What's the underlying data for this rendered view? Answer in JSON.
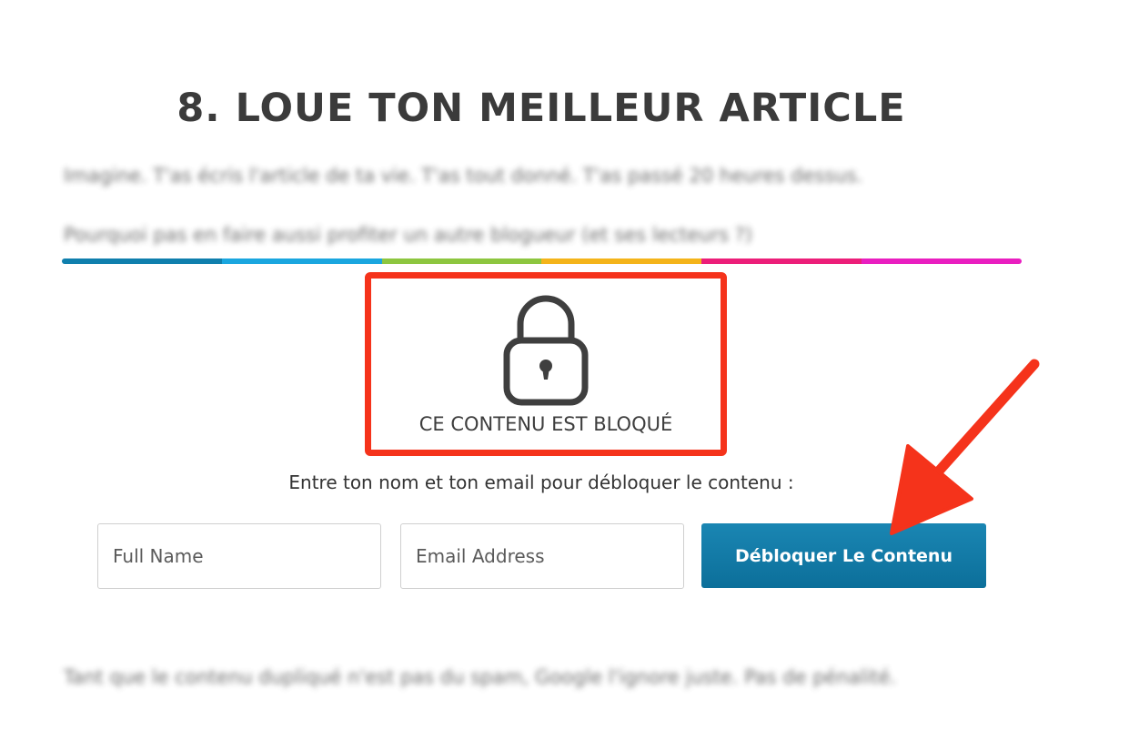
{
  "section": {
    "heading": "8. LOUE TON MEILLEUR ARTICLE",
    "paragraphs": [
      "Imagine. T'as écris l'article de ta vie. T'as tout donné. T'as passé 20 heures dessus.",
      "Pourquoi pas en faire aussi profiter un autre blogueur (et ses lecteurs ?)",
      "Tant que le contenu dupliqué n'est pas du spam, Google l'ignore juste. Pas de pénalité."
    ]
  },
  "divider": {
    "colors": [
      "#0f7fad",
      "#1aa6df",
      "#8dc63f",
      "#f4b41a",
      "#ec1e79",
      "#e91ec0"
    ]
  },
  "locked_box": {
    "icon": "padlock-icon",
    "label": "CE CONTENU EST BLOQUÉ",
    "highlight_color": "#f5331b"
  },
  "unlock_form": {
    "instruction": "Entre ton nom et ton email pour débloquer le contenu :",
    "name_placeholder": "Full Name",
    "email_placeholder": "Email Address",
    "button_label": "Débloquer Le Contenu",
    "button_color": "#0e78a5"
  },
  "annotation": {
    "icon": "red-arrow-icon",
    "color": "#f5331b"
  }
}
